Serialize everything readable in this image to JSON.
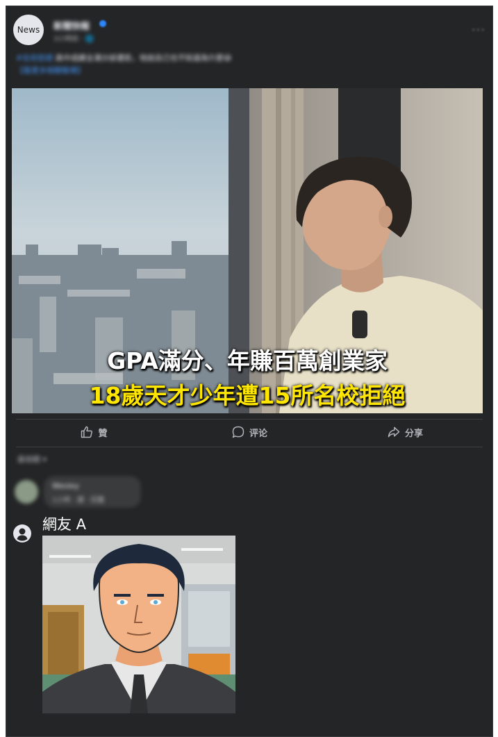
{
  "post": {
    "avatar_text": "News",
    "page_name": "新聞快報",
    "time": "3小時前 · 🌐",
    "more": "···",
    "caption_tag": "#名校拒絕",
    "caption_text": "高中成績全滿分卻遭拒，他說自己也不知道為什麼😅",
    "caption_link": "【看更多相關報導】",
    "image_line1": "GPA滿分、年賺百萬創業家",
    "image_line2": "18歲天才少年遭15所名校拒絕",
    "line2_color": "#ffe600"
  },
  "actions": {
    "like": "贊",
    "comment": "评论",
    "share": "分享"
  },
  "comments": {
    "sort_label": "最相關 ▾",
    "blurred": {
      "name": "Wesley",
      "meta": "1小時 · 讚 · 回覆"
    },
    "reply": {
      "name": "網友 A",
      "image_icon": "cartoon-businessman-image"
    }
  },
  "theme": {
    "background": "#242526",
    "text": "#e4e6eb",
    "muted": "#b0b3b8"
  }
}
